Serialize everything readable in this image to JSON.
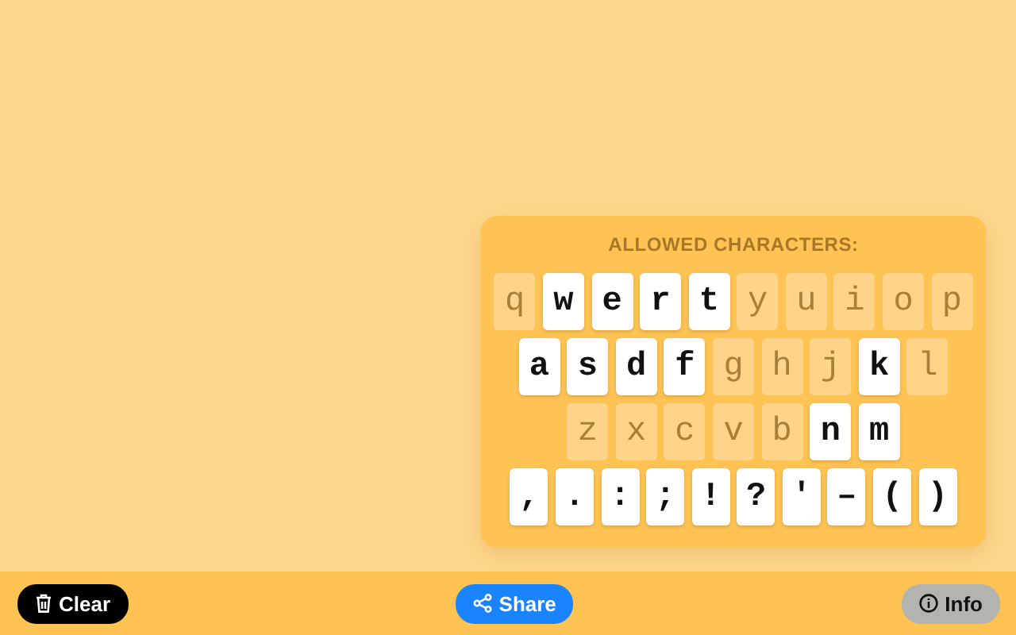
{
  "keyboard": {
    "title": "ALLOWED CHARACTERS:",
    "rows": [
      [
        {
          "char": "q",
          "allowed": false
        },
        {
          "char": "w",
          "allowed": true
        },
        {
          "char": "e",
          "allowed": true
        },
        {
          "char": "r",
          "allowed": true
        },
        {
          "char": "t",
          "allowed": true
        },
        {
          "char": "y",
          "allowed": false
        },
        {
          "char": "u",
          "allowed": false
        },
        {
          "char": "i",
          "allowed": false
        },
        {
          "char": "o",
          "allowed": false
        },
        {
          "char": "p",
          "allowed": false
        }
      ],
      [
        {
          "char": "a",
          "allowed": true
        },
        {
          "char": "s",
          "allowed": true
        },
        {
          "char": "d",
          "allowed": true
        },
        {
          "char": "f",
          "allowed": true
        },
        {
          "char": "g",
          "allowed": false
        },
        {
          "char": "h",
          "allowed": false
        },
        {
          "char": "j",
          "allowed": false
        },
        {
          "char": "k",
          "allowed": true
        },
        {
          "char": "l",
          "allowed": false
        }
      ],
      [
        {
          "char": "z",
          "allowed": false
        },
        {
          "char": "x",
          "allowed": false
        },
        {
          "char": "c",
          "allowed": false
        },
        {
          "char": "v",
          "allowed": false
        },
        {
          "char": "b",
          "allowed": false
        },
        {
          "char": "n",
          "allowed": true
        },
        {
          "char": "m",
          "allowed": true
        }
      ],
      [
        {
          "char": ",",
          "allowed": true
        },
        {
          "char": ".",
          "allowed": true
        },
        {
          "char": ":",
          "allowed": true
        },
        {
          "char": ";",
          "allowed": true
        },
        {
          "char": "!",
          "allowed": true
        },
        {
          "char": "?",
          "allowed": true
        },
        {
          "char": "'",
          "allowed": true
        },
        {
          "char": "–",
          "allowed": true
        },
        {
          "char": "(",
          "allowed": true
        },
        {
          "char": ")",
          "allowed": true
        }
      ]
    ]
  },
  "toolbar": [
    {
      "kind": "clear",
      "label": "Clear"
    },
    {
      "kind": "share",
      "label": "Share"
    },
    {
      "kind": "info",
      "label": "Info"
    }
  ]
}
